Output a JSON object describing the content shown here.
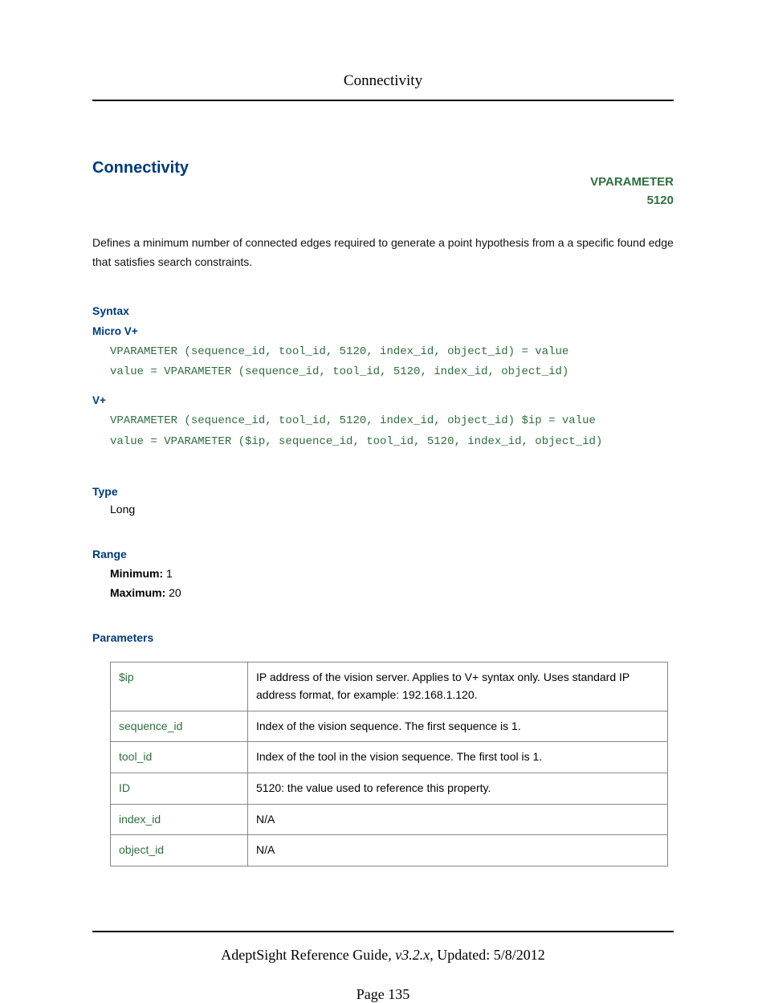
{
  "header": {
    "title": "Connectivity"
  },
  "main": {
    "section_title": "Connectivity",
    "vparam_label": "VPARAMETER",
    "vparam_code": "5120",
    "intro": "Defines a minimum number of connected edges required to generate a point hypothesis from a a specific found edge that satisfies search constraints.",
    "syntax": {
      "heading": "Syntax",
      "micro_heading": "Micro V+",
      "micro_line1": "VPARAMETER (sequence_id, tool_id, 5120, index_id, object_id) = value",
      "micro_line2": "value = VPARAMETER (sequence_id, tool_id, 5120, index_id, object_id)",
      "vplus_heading": "V+",
      "vplus_line1": "VPARAMETER (sequence_id, tool_id, 5120, index_id, object_id) $ip = value",
      "vplus_line2": "value = VPARAMETER ($ip, sequence_id, tool_id, 5120, index_id, object_id)"
    },
    "type": {
      "heading": "Type",
      "value": "Long"
    },
    "range": {
      "heading": "Range",
      "min_label": "Minimum:",
      "min_value": "1",
      "max_label": "Maximum:",
      "max_value": "20"
    },
    "parameters": {
      "heading": "Parameters",
      "rows": [
        {
          "name": "$ip",
          "desc": "IP address of the vision server. Applies to V+ syntax only. Uses standard IP address format, for example: 192.168.1.120."
        },
        {
          "name": "sequence_id",
          "desc": "Index of the vision sequence. The first sequence is 1."
        },
        {
          "name": "tool_id",
          "desc": "Index of the tool in the vision sequence. The first tool is 1."
        },
        {
          "name": "ID",
          "desc": "5120: the value used to reference this property."
        },
        {
          "name": "index_id",
          "desc": "N/A"
        },
        {
          "name": "object_id",
          "desc": "N/A"
        }
      ]
    }
  },
  "footer": {
    "doc_title": "AdeptSight Reference Guide",
    "version": ", v3.2.x",
    "updated": ", Updated: 5/8/2012",
    "page_label": "Page 135"
  }
}
